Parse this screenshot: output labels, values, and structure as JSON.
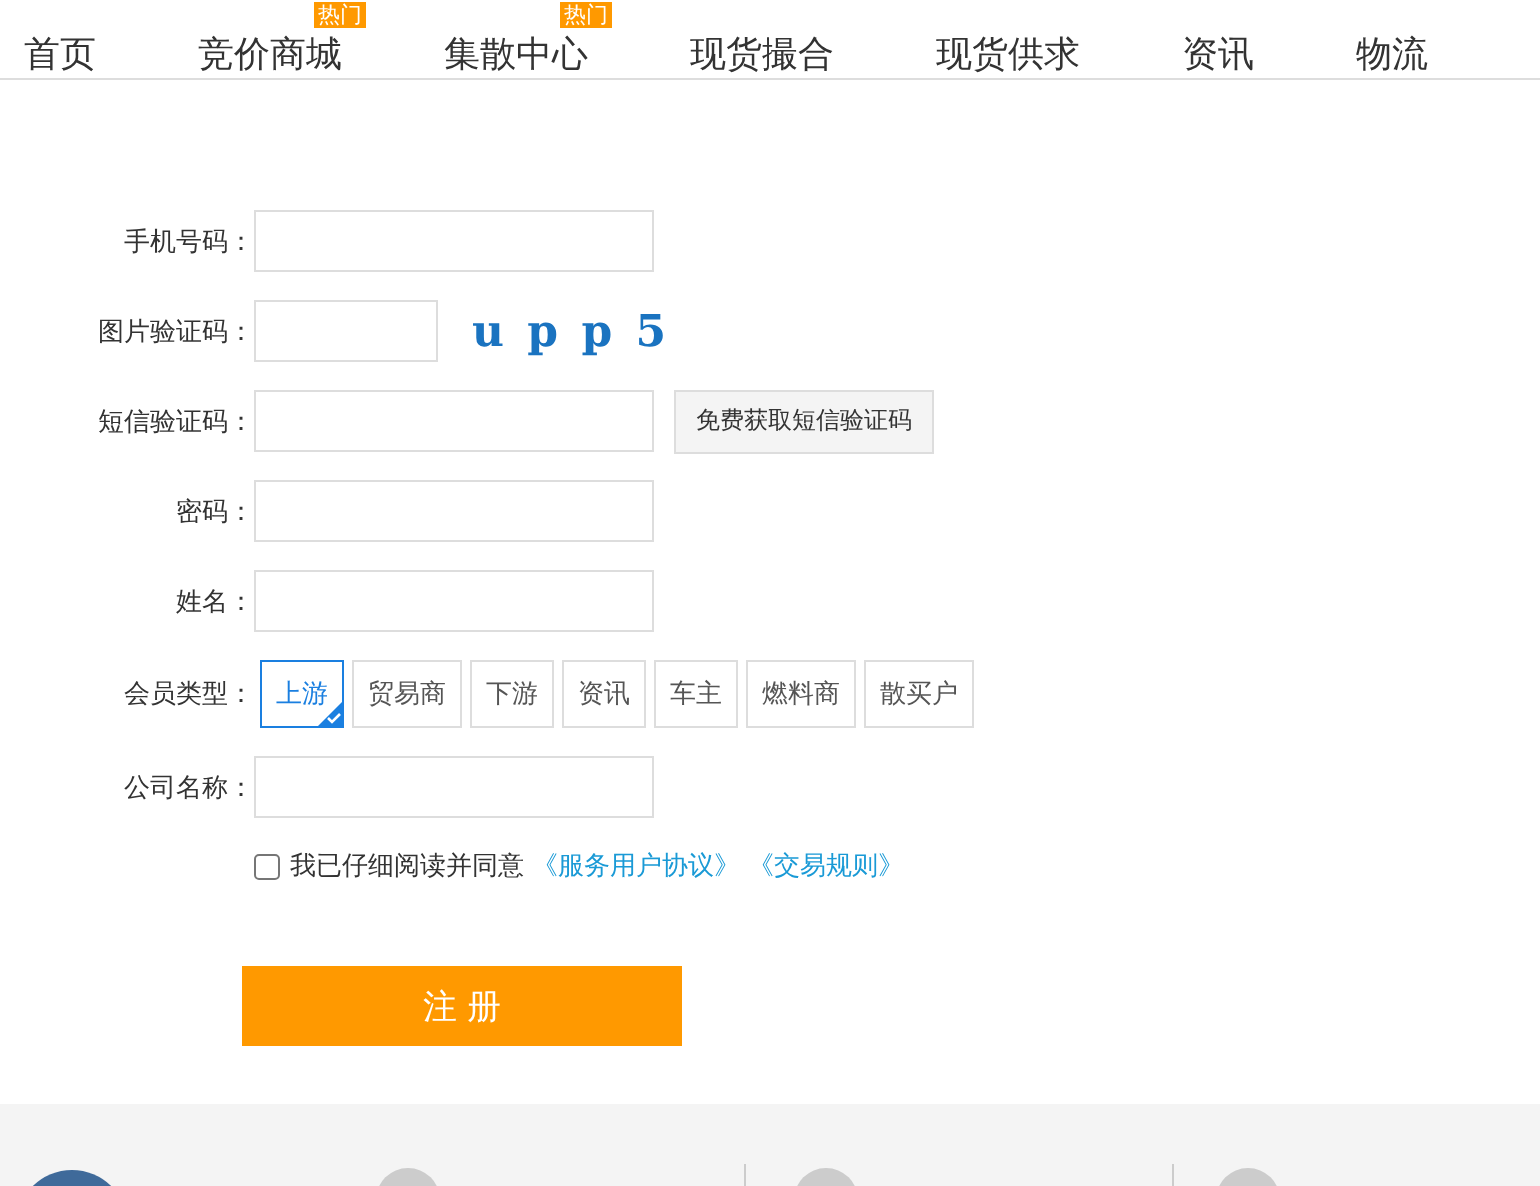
{
  "nav": [
    {
      "label": "首页"
    },
    {
      "label": "竞价商城",
      "badge": "热门"
    },
    {
      "label": "集散中心",
      "badge": "热门"
    },
    {
      "label": "现货撮合"
    },
    {
      "label": "现货供求"
    },
    {
      "label": "资讯"
    },
    {
      "label": "物流"
    }
  ],
  "form": {
    "fields": [
      {
        "kind": "text",
        "label": "手机号码："
      },
      {
        "kind": "captcha",
        "label": "图片验证码：",
        "captcha": "u p p 5"
      },
      {
        "kind": "sms",
        "label": "短信验证码：",
        "button": "免费获取短信验证码"
      },
      {
        "kind": "text",
        "label": "密码："
      },
      {
        "kind": "text",
        "label": "姓名："
      },
      {
        "kind": "types",
        "label": "会员类型：",
        "options": [
          {
            "label": "上游",
            "selected": true
          },
          {
            "label": "贸易商",
            "selected": false
          },
          {
            "label": "下游",
            "selected": false
          },
          {
            "label": "资讯",
            "selected": false
          },
          {
            "label": "车主",
            "selected": false
          },
          {
            "label": "燃料商",
            "selected": false
          },
          {
            "label": "散买户",
            "selected": false
          }
        ]
      },
      {
        "kind": "text",
        "label": "公司名称："
      }
    ],
    "agree": {
      "checked": false,
      "text": "我已仔细阅读并同意",
      "links": [
        "《服务用户协议》",
        "《交易规则》"
      ]
    },
    "submit": "注 册"
  }
}
